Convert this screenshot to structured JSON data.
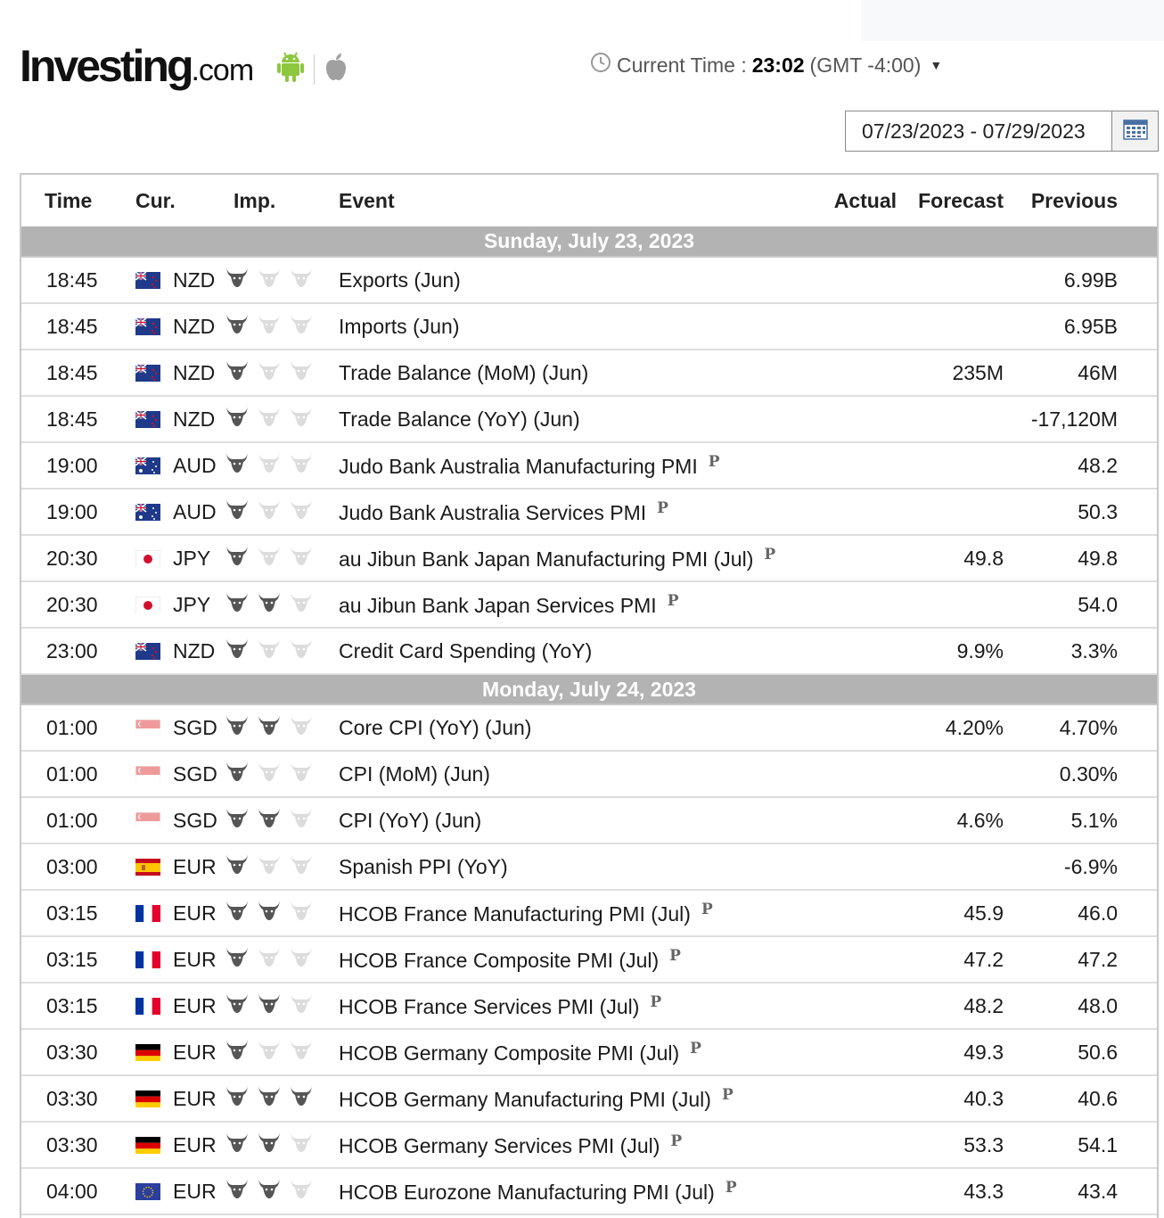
{
  "header": {
    "logo_main": "Investing",
    "logo_suffix": ".com",
    "current_time_label": "Current Time :",
    "current_time_value": "23:02",
    "timezone": "(GMT -4:00)",
    "date_range": "07/23/2023 - 07/29/2023"
  },
  "colors": {
    "accent_green": "#8dc63f",
    "apple_grey": "#a0a0a0",
    "day_band": "#b3b3b3",
    "bull": "#555555",
    "bull_off": "#dcdcdc"
  },
  "table": {
    "columns": [
      "Time",
      "Cur.",
      "Imp.",
      "Event",
      "Actual",
      "Forecast",
      "Previous"
    ],
    "days": [
      {
        "label": "Sunday, July 23, 2023",
        "events": [
          {
            "time": "18:45",
            "flag": "NZ",
            "cur": "NZD",
            "imp": 1,
            "event": "Exports (Jun)",
            "prelim": "",
            "actual": "",
            "forecast": "",
            "previous": "6.99B"
          },
          {
            "time": "18:45",
            "flag": "NZ",
            "cur": "NZD",
            "imp": 1,
            "event": "Imports (Jun)",
            "prelim": "",
            "actual": "",
            "forecast": "",
            "previous": "6.95B"
          },
          {
            "time": "18:45",
            "flag": "NZ",
            "cur": "NZD",
            "imp": 1,
            "event": "Trade Balance (MoM) (Jun)",
            "prelim": "",
            "actual": "",
            "forecast": "235M",
            "previous": "46M"
          },
          {
            "time": "18:45",
            "flag": "NZ",
            "cur": "NZD",
            "imp": 1,
            "event": "Trade Balance (YoY) (Jun)",
            "prelim": "",
            "actual": "",
            "forecast": "",
            "previous": "-17,120M"
          },
          {
            "time": "19:00",
            "flag": "AU",
            "cur": "AUD",
            "imp": 1,
            "event": "Judo Bank Australia Manufacturing PMI",
            "prelim": "P",
            "actual": "",
            "forecast": "",
            "previous": "48.2"
          },
          {
            "time": "19:00",
            "flag": "AU",
            "cur": "AUD",
            "imp": 1,
            "event": "Judo Bank Australia Services PMI",
            "prelim": "P",
            "actual": "",
            "forecast": "",
            "previous": "50.3"
          },
          {
            "time": "20:30",
            "flag": "JP",
            "cur": "JPY",
            "imp": 1,
            "event": "au Jibun Bank Japan Manufacturing PMI (Jul)",
            "prelim": "P",
            "actual": "",
            "forecast": "49.8",
            "previous": "49.8"
          },
          {
            "time": "20:30",
            "flag": "JP",
            "cur": "JPY",
            "imp": 2,
            "event": "au Jibun Bank Japan Services PMI",
            "prelim": "P",
            "actual": "",
            "forecast": "",
            "previous": "54.0"
          },
          {
            "time": "23:00",
            "flag": "NZ",
            "cur": "NZD",
            "imp": 1,
            "event": "Credit Card Spending (YoY)",
            "prelim": "",
            "actual": "",
            "forecast": "9.9%",
            "previous": "3.3%"
          }
        ]
      },
      {
        "label": "Monday, July 24, 2023",
        "events": [
          {
            "time": "01:00",
            "flag": "SG",
            "cur": "SGD",
            "imp": 2,
            "event": "Core CPI (YoY) (Jun)",
            "prelim": "",
            "actual": "",
            "forecast": "4.20%",
            "previous": "4.70%"
          },
          {
            "time": "01:00",
            "flag": "SG",
            "cur": "SGD",
            "imp": 1,
            "event": "CPI (MoM) (Jun)",
            "prelim": "",
            "actual": "",
            "forecast": "",
            "previous": "0.30%"
          },
          {
            "time": "01:00",
            "flag": "SG",
            "cur": "SGD",
            "imp": 2,
            "event": "CPI (YoY) (Jun)",
            "prelim": "",
            "actual": "",
            "forecast": "4.6%",
            "previous": "5.1%"
          },
          {
            "time": "03:00",
            "flag": "ES",
            "cur": "EUR",
            "imp": 1,
            "event": "Spanish PPI (YoY)",
            "prelim": "",
            "actual": "",
            "forecast": "",
            "previous": "-6.9%"
          },
          {
            "time": "03:15",
            "flag": "FR",
            "cur": "EUR",
            "imp": 2,
            "event": "HCOB France Manufacturing PMI (Jul)",
            "prelim": "P",
            "actual": "",
            "forecast": "45.9",
            "previous": "46.0"
          },
          {
            "time": "03:15",
            "flag": "FR",
            "cur": "EUR",
            "imp": 1,
            "event": "HCOB France Composite PMI (Jul)",
            "prelim": "P",
            "actual": "",
            "forecast": "47.2",
            "previous": "47.2"
          },
          {
            "time": "03:15",
            "flag": "FR",
            "cur": "EUR",
            "imp": 2,
            "event": "HCOB France Services PMI (Jul)",
            "prelim": "P",
            "actual": "",
            "forecast": "48.2",
            "previous": "48.0"
          },
          {
            "time": "03:30",
            "flag": "DE",
            "cur": "EUR",
            "imp": 1,
            "event": "HCOB Germany Composite PMI (Jul)",
            "prelim": "P",
            "actual": "",
            "forecast": "49.3",
            "previous": "50.6"
          },
          {
            "time": "03:30",
            "flag": "DE",
            "cur": "EUR",
            "imp": 3,
            "event": "HCOB Germany Manufacturing PMI (Jul)",
            "prelim": "P",
            "actual": "",
            "forecast": "40.3",
            "previous": "40.6"
          },
          {
            "time": "03:30",
            "flag": "DE",
            "cur": "EUR",
            "imp": 2,
            "event": "HCOB Germany Services PMI (Jul)",
            "prelim": "P",
            "actual": "",
            "forecast": "53.3",
            "previous": "54.1"
          },
          {
            "time": "04:00",
            "flag": "EU",
            "cur": "EUR",
            "imp": 2,
            "event": "HCOB Eurozone Manufacturing PMI (Jul)",
            "prelim": "P",
            "actual": "",
            "forecast": "43.3",
            "previous": "43.4"
          }
        ]
      }
    ]
  }
}
